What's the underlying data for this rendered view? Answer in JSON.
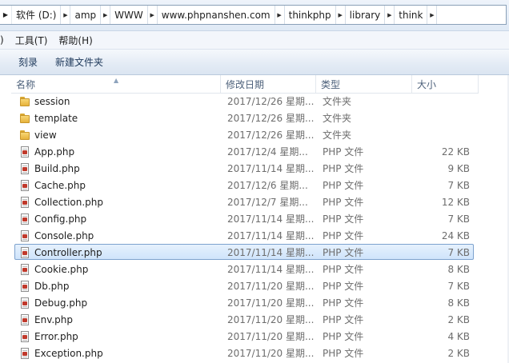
{
  "address_bar": {
    "crumbs": [
      "软件 (D:)",
      "amp",
      "WWW",
      "www.phpnanshen.com",
      "thinkphp",
      "library",
      "think"
    ]
  },
  "menu": {
    "items": [
      ")",
      "工具(T)",
      "帮助(H)"
    ]
  },
  "toolbar": {
    "burn_label": "刻录",
    "new_folder_label": "新建文件夹"
  },
  "columns": {
    "name": "名称",
    "date": "修改日期",
    "type": "类型",
    "size": "大小"
  },
  "files": [
    {
      "name": "session",
      "date": "2017/12/26 星期...",
      "type": "文件夹",
      "size": "",
      "icon": "folder-icon"
    },
    {
      "name": "template",
      "date": "2017/12/26 星期...",
      "type": "文件夹",
      "size": "",
      "icon": "folder-icon"
    },
    {
      "name": "view",
      "date": "2017/12/26 星期...",
      "type": "文件夹",
      "size": "",
      "icon": "folder-icon"
    },
    {
      "name": "App.php",
      "date": "2017/12/4 星期...",
      "type": "PHP 文件",
      "size": "22 KB",
      "icon": "php-file-icon"
    },
    {
      "name": "Build.php",
      "date": "2017/11/14 星期...",
      "type": "PHP 文件",
      "size": "9 KB",
      "icon": "php-file-icon"
    },
    {
      "name": "Cache.php",
      "date": "2017/12/6 星期...",
      "type": "PHP 文件",
      "size": "7 KB",
      "icon": "php-file-icon"
    },
    {
      "name": "Collection.php",
      "date": "2017/12/7 星期...",
      "type": "PHP 文件",
      "size": "12 KB",
      "icon": "php-file-icon"
    },
    {
      "name": "Config.php",
      "date": "2017/11/14 星期...",
      "type": "PHP 文件",
      "size": "7 KB",
      "icon": "php-file-icon"
    },
    {
      "name": "Console.php",
      "date": "2017/11/14 星期...",
      "type": "PHP 文件",
      "size": "24 KB",
      "icon": "php-file-icon"
    },
    {
      "name": "Controller.php",
      "date": "2017/11/14 星期...",
      "type": "PHP 文件",
      "size": "7 KB",
      "icon": "php-file-icon",
      "selected": true
    },
    {
      "name": "Cookie.php",
      "date": "2017/11/14 星期...",
      "type": "PHP 文件",
      "size": "8 KB",
      "icon": "php-file-icon"
    },
    {
      "name": "Db.php",
      "date": "2017/11/20 星期...",
      "type": "PHP 文件",
      "size": "7 KB",
      "icon": "php-file-icon"
    },
    {
      "name": "Debug.php",
      "date": "2017/11/20 星期...",
      "type": "PHP 文件",
      "size": "8 KB",
      "icon": "php-file-icon"
    },
    {
      "name": "Env.php",
      "date": "2017/11/20 星期...",
      "type": "PHP 文件",
      "size": "2 KB",
      "icon": "php-file-icon"
    },
    {
      "name": "Error.php",
      "date": "2017/11/20 星期...",
      "type": "PHP 文件",
      "size": "4 KB",
      "icon": "php-file-icon"
    },
    {
      "name": "Exception.php",
      "date": "2017/11/20 星期...",
      "type": "PHP 文件",
      "size": "2 KB",
      "icon": "php-file-icon"
    }
  ],
  "colors": {
    "selection_bg": "#cfe4fb",
    "selection_border": "#7da2ce",
    "header_text": "#4c607a",
    "secondary_text": "#6d6d6d"
  }
}
